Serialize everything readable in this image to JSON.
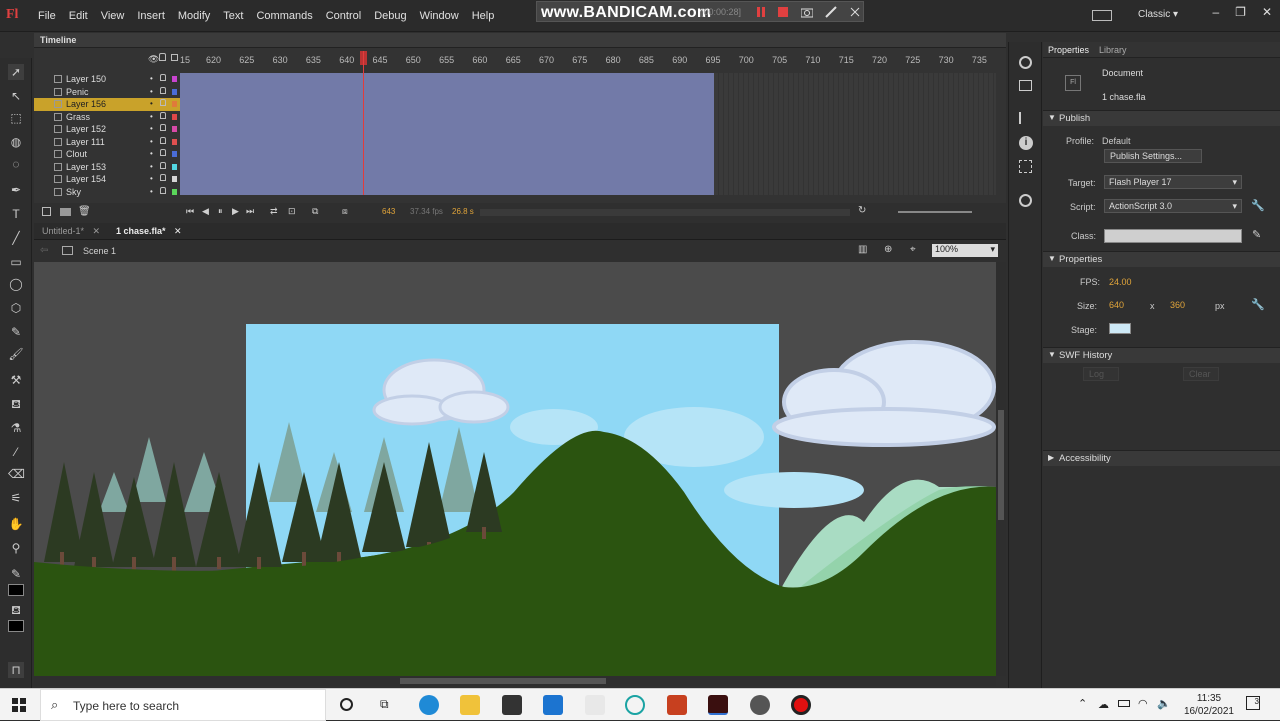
{
  "menubar": {
    "logo": "Fl",
    "items": [
      "File",
      "Edit",
      "View",
      "Insert",
      "Modify",
      "Text",
      "Commands",
      "Control",
      "Debug",
      "Window",
      "Help"
    ],
    "workspace": "Classic"
  },
  "bandicam": {
    "brand": "www.BANDICAM.com",
    "timer": "[00:00:28]"
  },
  "timeline": {
    "title": "Timeline",
    "ruler_ticks": [
      "15",
      "620",
      "625",
      "630",
      "635",
      "640",
      "645",
      "650",
      "655",
      "660",
      "665",
      "670",
      "675",
      "680",
      "685",
      "690",
      "695",
      "700",
      "705",
      "710",
      "715",
      "720",
      "725",
      "730",
      "735"
    ],
    "layers": [
      {
        "name": "Layer 150",
        "color": "#c944d0"
      },
      {
        "name": "Penic",
        "color": "#4a6cd6"
      },
      {
        "name": "Layer 156",
        "color": "#e07a3a"
      },
      {
        "name": "Grass",
        "color": "#e04848"
      },
      {
        "name": "Layer 152",
        "color": "#d84aa8"
      },
      {
        "name": "Layer 111",
        "color": "#e05050"
      },
      {
        "name": "Clout",
        "color": "#4a6cd6"
      },
      {
        "name": "Layer 153",
        "color": "#52d6e0"
      },
      {
        "name": "Layer 154",
        "color": "#d6d6d6"
      },
      {
        "name": "Sky",
        "color": "#5ad65a"
      }
    ],
    "current_frame": "643",
    "fps": "37.34 fps",
    "time": "26.8 s"
  },
  "doc_tabs": [
    {
      "label": "Untitled-1*"
    },
    {
      "label": "1 chase.fla*"
    }
  ],
  "scene": {
    "label": "Scene 1",
    "zoom": "100%"
  },
  "panel": {
    "tabs": [
      "Properties",
      "Library"
    ],
    "doc_type": "Document",
    "doc_name": "1 chase.fla",
    "publish": {
      "header": "Publish",
      "profile_label": "Profile:",
      "profile_value": "Default",
      "settings_button": "Publish Settings...",
      "target_label": "Target:",
      "target_value": "Flash Player 17",
      "script_label": "Script:",
      "script_value": "ActionScript 3.0",
      "class_label": "Class:"
    },
    "properties": {
      "header": "Properties",
      "fps_label": "FPS:",
      "fps_value": "24.00",
      "size_label": "Size:",
      "width": "640",
      "x": "x",
      "height": "360",
      "unit": "px",
      "stage_label": "Stage:",
      "stage_color": "#cde9f6"
    },
    "swf_history": {
      "header": "SWF History",
      "log": "Log",
      "clear": "Clear"
    },
    "accessibility": {
      "header": "Accessibility"
    }
  },
  "taskbar": {
    "search_placeholder": "Type here to search",
    "time": "11:35",
    "date": "16/02/2021",
    "notification_count": "3"
  }
}
